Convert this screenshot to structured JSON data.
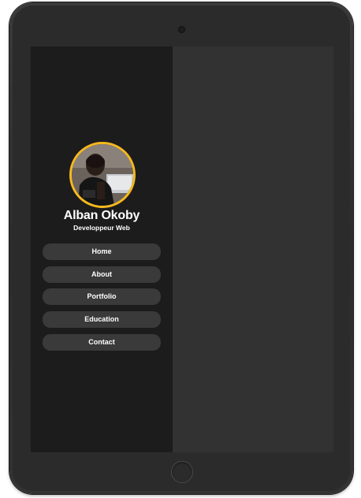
{
  "profile": {
    "name": "Alban Okoby",
    "role": "Developpeur Web",
    "avatar_alt": "profile-photo"
  },
  "nav": {
    "items": [
      {
        "label": "Home"
      },
      {
        "label": "About"
      },
      {
        "label": "Portfolio"
      },
      {
        "label": "Education"
      },
      {
        "label": "Contact"
      }
    ]
  },
  "colors": {
    "sidebar_bg": "#1c1c1c",
    "main_bg": "#323232",
    "avatar_border": "#f5b91e",
    "nav_item_bg": "#3a3a3a",
    "text": "#ffffff"
  }
}
